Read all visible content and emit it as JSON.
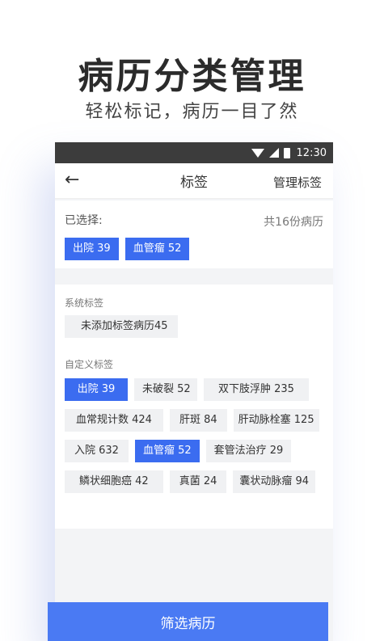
{
  "promo": {
    "title": "病历分类管理",
    "subtitle": "轻松标记，病历一目了然"
  },
  "statusbar": {
    "time": "12:30"
  },
  "navbar": {
    "title": "标签",
    "manage": "管理标签"
  },
  "selected": {
    "label": "已选择:",
    "count": "共16份病历",
    "chips": [
      "出院 39",
      "血管瘤 52"
    ]
  },
  "system_tags": {
    "label": "系统标签",
    "items": [
      "未添加标签病历45"
    ]
  },
  "custom_tags": {
    "label": "自定义标签",
    "rows": [
      [
        "出院 39",
        "未破裂 52",
        "双下肢浮肿 235"
      ],
      [
        "血常规计数 424",
        "肝斑 84",
        "肝动脉栓塞 125"
      ],
      [
        "入院 632",
        "血管瘤 52",
        "套管法治疗 29"
      ],
      [
        "鳞状细胞癌 42",
        "真菌 24",
        "囊状动脉瘤 94"
      ]
    ]
  },
  "filter_button": {
    "label": "筛选病历"
  },
  "colors": {
    "accent": "#3b6cf0",
    "button": "#4a7af3",
    "statusbar": "#3c3c3c"
  }
}
